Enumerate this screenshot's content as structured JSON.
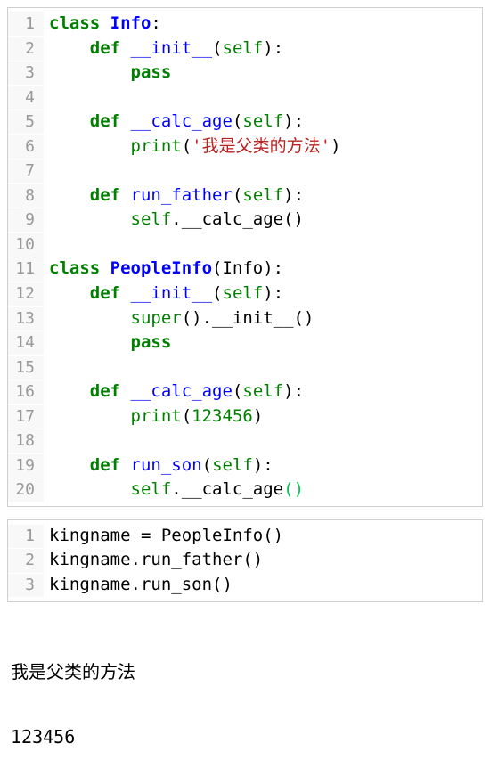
{
  "block1": {
    "lines": [
      {
        "n": "1",
        "tokens": [
          {
            "t": "class ",
            "c": "kw"
          },
          {
            "t": "Info",
            "c": "cls"
          },
          {
            "t": ":",
            "c": "plain"
          }
        ]
      },
      {
        "n": "2",
        "tokens": [
          {
            "t": "    ",
            "c": "plain"
          },
          {
            "t": "def ",
            "c": "kw"
          },
          {
            "t": "__init__",
            "c": "func"
          },
          {
            "t": "(",
            "c": "plain"
          },
          {
            "t": "self",
            "c": "builtin"
          },
          {
            "t": "):",
            "c": "plain"
          }
        ]
      },
      {
        "n": "3",
        "tokens": [
          {
            "t": "        ",
            "c": "plain"
          },
          {
            "t": "pass",
            "c": "kw"
          }
        ]
      },
      {
        "n": "4",
        "tokens": []
      },
      {
        "n": "5",
        "tokens": [
          {
            "t": "    ",
            "c": "plain"
          },
          {
            "t": "def ",
            "c": "kw"
          },
          {
            "t": "__calc_age",
            "c": "func"
          },
          {
            "t": "(",
            "c": "plain"
          },
          {
            "t": "self",
            "c": "builtin"
          },
          {
            "t": "):",
            "c": "plain"
          }
        ]
      },
      {
        "n": "6",
        "tokens": [
          {
            "t": "        ",
            "c": "plain"
          },
          {
            "t": "print",
            "c": "builtin"
          },
          {
            "t": "(",
            "c": "plain"
          },
          {
            "t": "'我是父类的方法'",
            "c": "str"
          },
          {
            "t": ")",
            "c": "plain"
          }
        ]
      },
      {
        "n": "7",
        "tokens": []
      },
      {
        "n": "8",
        "tokens": [
          {
            "t": "    ",
            "c": "plain"
          },
          {
            "t": "def ",
            "c": "kw"
          },
          {
            "t": "run_father",
            "c": "func"
          },
          {
            "t": "(",
            "c": "plain"
          },
          {
            "t": "self",
            "c": "builtin"
          },
          {
            "t": "):",
            "c": "plain"
          }
        ]
      },
      {
        "n": "9",
        "tokens": [
          {
            "t": "        ",
            "c": "plain"
          },
          {
            "t": "self",
            "c": "builtin"
          },
          {
            "t": ".__calc_age()",
            "c": "plain"
          }
        ]
      },
      {
        "n": "10",
        "tokens": []
      },
      {
        "n": "11",
        "tokens": [
          {
            "t": "class ",
            "c": "kw"
          },
          {
            "t": "PeopleInfo",
            "c": "cls"
          },
          {
            "t": "(Info):",
            "c": "plain"
          }
        ]
      },
      {
        "n": "12",
        "tokens": [
          {
            "t": "    ",
            "c": "plain"
          },
          {
            "t": "def ",
            "c": "kw"
          },
          {
            "t": "__init__",
            "c": "func"
          },
          {
            "t": "(",
            "c": "plain"
          },
          {
            "t": "self",
            "c": "builtin"
          },
          {
            "t": "):",
            "c": "plain"
          }
        ]
      },
      {
        "n": "13",
        "tokens": [
          {
            "t": "        ",
            "c": "plain"
          },
          {
            "t": "super",
            "c": "builtin"
          },
          {
            "t": "().__init__()",
            "c": "plain"
          }
        ]
      },
      {
        "n": "14",
        "tokens": [
          {
            "t": "        ",
            "c": "plain"
          },
          {
            "t": "pass",
            "c": "kw"
          }
        ]
      },
      {
        "n": "15",
        "tokens": []
      },
      {
        "n": "16",
        "tokens": [
          {
            "t": "    ",
            "c": "plain"
          },
          {
            "t": "def ",
            "c": "kw"
          },
          {
            "t": "__calc_age",
            "c": "func"
          },
          {
            "t": "(",
            "c": "plain"
          },
          {
            "t": "self",
            "c": "builtin"
          },
          {
            "t": "):",
            "c": "plain"
          }
        ]
      },
      {
        "n": "17",
        "tokens": [
          {
            "t": "        ",
            "c": "plain"
          },
          {
            "t": "print",
            "c": "builtin"
          },
          {
            "t": "(",
            "c": "plain"
          },
          {
            "t": "123456",
            "c": "num"
          },
          {
            "t": ")",
            "c": "plain"
          }
        ]
      },
      {
        "n": "18",
        "tokens": []
      },
      {
        "n": "19",
        "tokens": [
          {
            "t": "    ",
            "c": "plain"
          },
          {
            "t": "def ",
            "c": "kw"
          },
          {
            "t": "run_son",
            "c": "func"
          },
          {
            "t": "(",
            "c": "plain"
          },
          {
            "t": "self",
            "c": "builtin"
          },
          {
            "t": "):",
            "c": "plain"
          }
        ]
      },
      {
        "n": "20",
        "tokens": [
          {
            "t": "        ",
            "c": "plain"
          },
          {
            "t": "self",
            "c": "builtin"
          },
          {
            "t": ".__calc_age",
            "c": "plain"
          },
          {
            "t": "(",
            "c": "paren-hl"
          },
          {
            "t": ")",
            "c": "paren-hl"
          }
        ]
      }
    ]
  },
  "block2": {
    "lines": [
      {
        "n": "1",
        "tokens": [
          {
            "t": "kingname = PeopleInfo()",
            "c": "plain"
          }
        ]
      },
      {
        "n": "2",
        "tokens": [
          {
            "t": "kingname.run_father()",
            "c": "plain"
          }
        ]
      },
      {
        "n": "3",
        "tokens": [
          {
            "t": "kingname.run_son()",
            "c": "plain"
          }
        ]
      }
    ]
  },
  "output": {
    "line1": "我是父类的方法",
    "line2": "123456"
  }
}
